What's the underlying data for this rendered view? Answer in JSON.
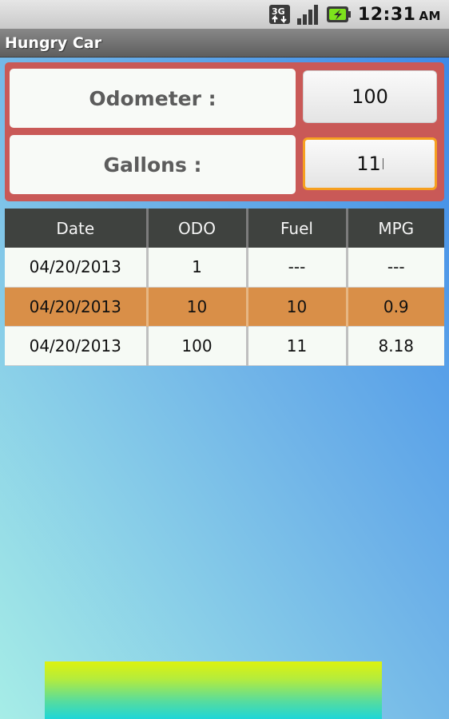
{
  "status_bar": {
    "time": "12:31",
    "ampm": "AM",
    "icons": [
      "3g-data-icon",
      "signal-strength-icon",
      "battery-charging-icon"
    ]
  },
  "app": {
    "title": "Hungry Car"
  },
  "inputs": {
    "odometer_label": "Odometer :",
    "odometer_value": "100",
    "gallons_label": "Gallons :",
    "gallons_value": "11"
  },
  "table": {
    "headers": [
      "Date",
      "ODO",
      "Fuel",
      "MPG"
    ],
    "rows": [
      {
        "date": "04/20/2013",
        "odo": "1",
        "fuel": "---",
        "mpg": "---"
      },
      {
        "date": "04/20/2013",
        "odo": "10",
        "fuel": "10",
        "mpg": "0.9"
      },
      {
        "date": "04/20/2013",
        "odo": "100",
        "fuel": "11",
        "mpg": "8.18"
      }
    ]
  },
  "colors": {
    "panel_bg": "#c95957",
    "highlight_row": "#d98f48",
    "focus_border": "#f6a020",
    "header_bg": "#3f423f"
  }
}
